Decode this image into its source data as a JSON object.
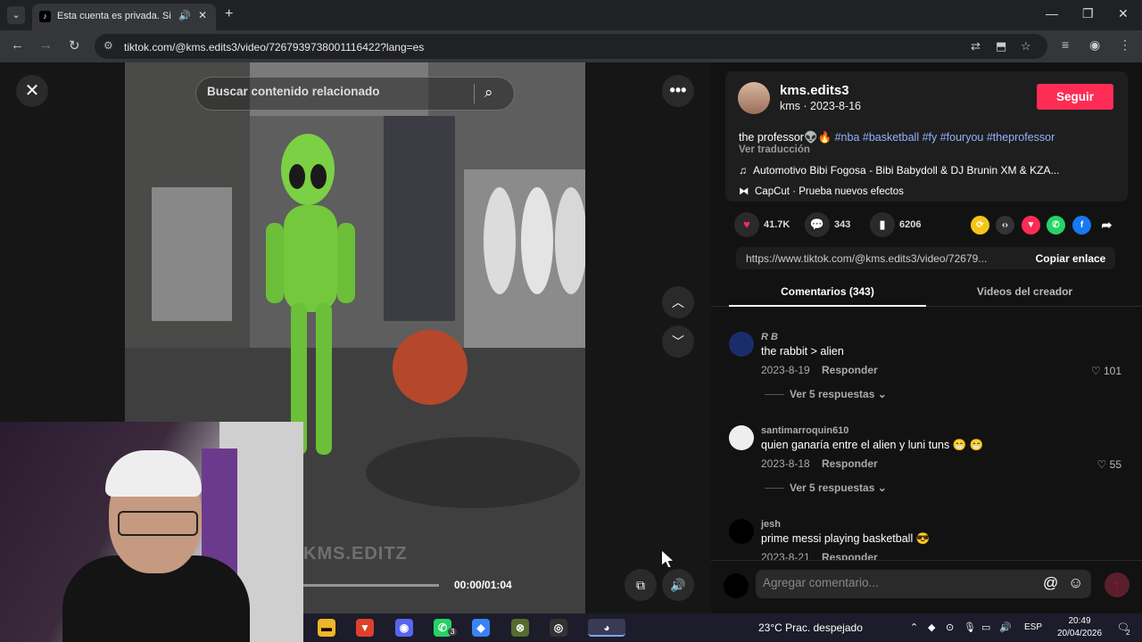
{
  "browser": {
    "tab_title": "Esta cuenta es privada. Sigu",
    "url": "tiktok.com/@kms.edits3/video/7267939738001116422?lang=es"
  },
  "video": {
    "search_placeholder": "Buscar contenido relacionado",
    "time": "00:00/01:04",
    "watermark": "KMS.EDITZ"
  },
  "creator": {
    "username": "kms.edits3",
    "nickname_date": "kms · 2023-8-16",
    "follow_label": "Seguir"
  },
  "post": {
    "caption_prefix": "the professor",
    "hashtags": "#nba #basketball #fy #fouryou #theprofessor",
    "translate": "Ver traducción",
    "music": "Automotivo Bibi Fogosa - Bibi Babydoll & DJ Brunin XM & KZA...",
    "capcut": "CapCut · Prueba nuevos efectos"
  },
  "stats": {
    "likes": "41.7K",
    "comments": "343",
    "saves": "6206"
  },
  "share": {
    "link": "https://www.tiktok.com/@kms.edits3/video/72679...",
    "copy_label": "Copiar enlace"
  },
  "tabs": {
    "comments": "Comentarios (343)",
    "creator_videos": "Videos del creador"
  },
  "comments": [
    {
      "user": "R B",
      "text": "the rabbit > alien",
      "date": "2023-8-19",
      "reply": "Responder",
      "likes": "101",
      "view_replies": "Ver 5 respuestas"
    },
    {
      "user": "santimarroquin610",
      "text": "quien ganaría entre el alien y luni tuns 😁 😁",
      "date": "2023-8-18",
      "reply": "Responder",
      "likes": "55",
      "view_replies": "Ver 5 respuestas"
    },
    {
      "user": "jesh",
      "text": "prime messi playing basketball 😎",
      "date": "2023-8-21",
      "reply": "Responder",
      "likes": ""
    }
  ],
  "composer": {
    "placeholder": "Agregar comentario..."
  },
  "taskbar": {
    "weather": "23°C  Prac. despejado",
    "lang": "ESP",
    "time": "20:49",
    "date": "20/04/2026",
    "whatsapp_badge": "3",
    "notif_badge": "2"
  },
  "colors": {
    "accent": "#fe2c55",
    "hashtag": "#8fb2ff",
    "panel_bg": "#121212"
  }
}
